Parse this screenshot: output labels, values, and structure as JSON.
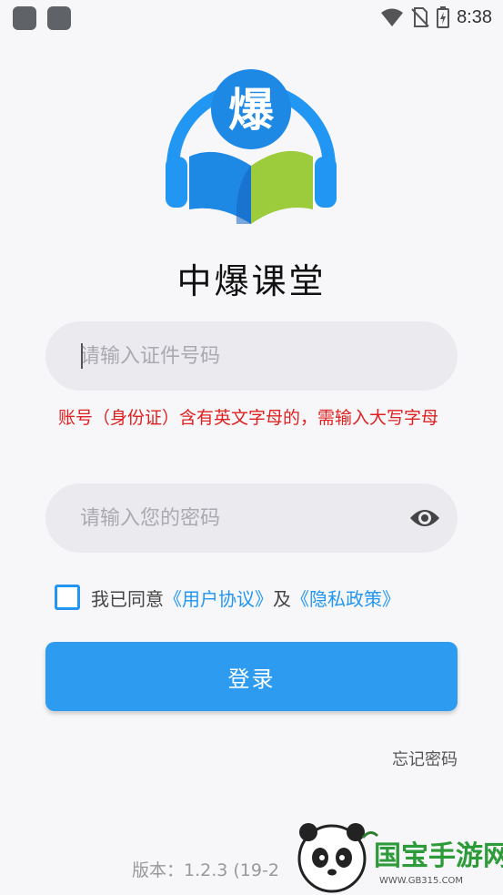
{
  "status_bar": {
    "time": "8:38",
    "icons": [
      "app-notification-icon",
      "app-notification-icon",
      "wifi-icon",
      "no-sim-icon",
      "battery-charging-icon"
    ]
  },
  "logo": {
    "glyph": "爆",
    "colors": {
      "ring": "#2196f3",
      "book_left": "#1e88e5",
      "book_right": "#9ccc3c"
    }
  },
  "app": {
    "title": "中爆课堂"
  },
  "form": {
    "id_placeholder": "请输入证件号码",
    "id_value": "",
    "hint": "账号（身份证）含有英文字母的，需输入大写字母",
    "password_placeholder": "请输入您的密码",
    "password_value": ""
  },
  "agreement": {
    "prefix": "我已同意",
    "user_agreement": "《用户协议》",
    "conjunction": "及",
    "privacy_policy": "《隐私政策》",
    "checked": false
  },
  "login_label": "登录",
  "forgot_label": "忘记密码",
  "version_text": "版本：1.2.3 (19-2",
  "watermark": {
    "brand": "国宝手游网",
    "url": "WWW.GB315.COM"
  },
  "colors": {
    "accent": "#2d9cf0",
    "error": "#e02020",
    "field_bg": "#ebebef"
  }
}
